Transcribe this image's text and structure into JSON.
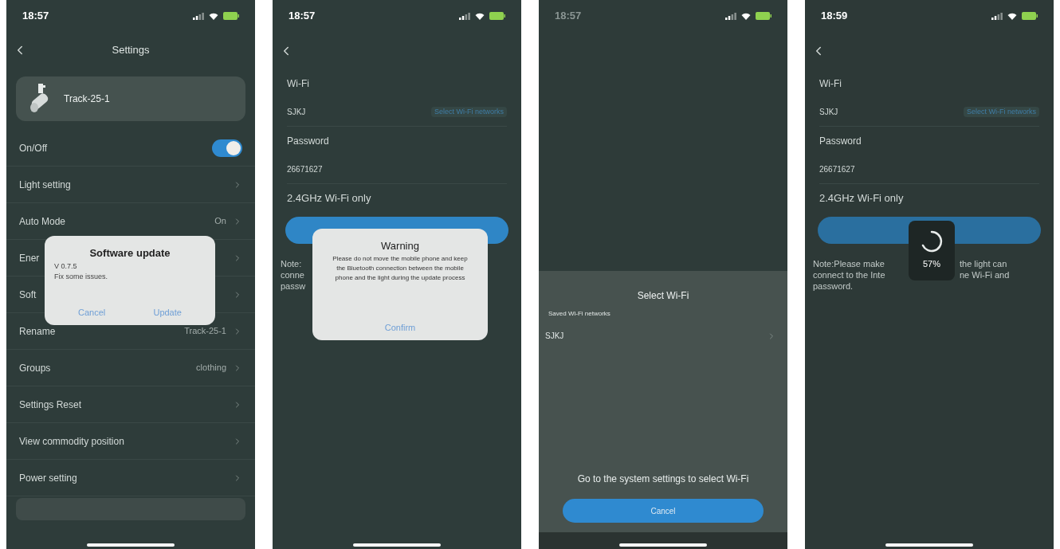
{
  "settings_screen": {
    "status_time": "18:57",
    "title": "Settings",
    "device_name": "Track-25-1",
    "rows": [
      {
        "kind": "toggle",
        "label": "On/Off",
        "on": true
      },
      {
        "kind": "link",
        "label": "Light setting"
      },
      {
        "kind": "link",
        "label": "Auto Mode",
        "value": "On"
      },
      {
        "kind": "link",
        "label": "Ener"
      },
      {
        "kind": "link",
        "label": "Soft"
      },
      {
        "kind": "link",
        "label": "Rename",
        "value": "Track-25-1"
      },
      {
        "kind": "link",
        "label": "Groups",
        "value": "clothing"
      },
      {
        "kind": "link",
        "label": "Settings Reset"
      },
      {
        "kind": "link",
        "label": "View commodity position"
      },
      {
        "kind": "link",
        "label": "Power setting"
      }
    ],
    "dialog": {
      "title": "Software update",
      "version": "V 0.7.5",
      "message": "Fix some issues.",
      "buttons": [
        "Cancel",
        "Update"
      ]
    }
  },
  "wifi_warning_screen": {
    "status_time": "18:57",
    "form": {
      "section_label": "Wi-Fi",
      "network": "SJKJ",
      "select_link": "Select Wi-Fi networks",
      "password_label": "Password",
      "password": "26671627",
      "band_note": "2.4GHz Wi-Fi only"
    },
    "note_lines": [
      [
        "Note:"
      ],
      [
        "conne"
      ],
      [
        "passw"
      ]
    ],
    "dialog": {
      "title": "Warning",
      "message": "Please do not move the mobile phone and keep the Bluetooth connection between the mobile phone and the light during the update process",
      "button": "Confirm"
    }
  },
  "select_wifi_screen": {
    "status_time": "18:57",
    "title": "Select Wi-Fi",
    "saved_label": "Saved Wi-Fi networks",
    "networks": [
      "SJKJ"
    ],
    "hint": "Go to the system settings to select Wi-Fi",
    "cancel": "Cancel"
  },
  "wifi_progress_screen": {
    "status_time": "18:59",
    "form": {
      "section_label": "Wi-Fi",
      "network": "SJKJ",
      "select_link": "Select Wi-Fi networks",
      "password_label": "Password",
      "password": "26671627",
      "band_note": "2.4GHz Wi-Fi only"
    },
    "note_lines": [
      [
        "Note:Please make",
        "the light can"
      ],
      [
        "connect to the Inte",
        "ne Wi-Fi and"
      ],
      [
        "password."
      ]
    ],
    "loader": {
      "percent": "57%"
    }
  }
}
